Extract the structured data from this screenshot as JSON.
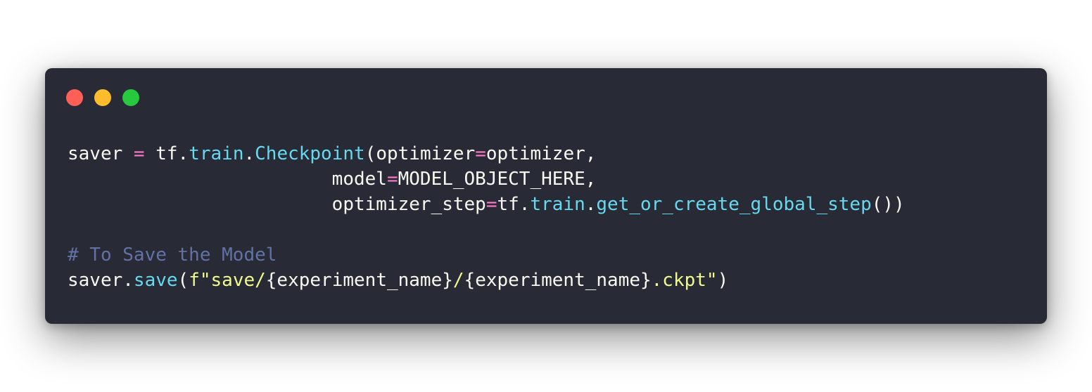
{
  "window": {
    "buttons": [
      {
        "name": "close",
        "color": "#ff5f56"
      },
      {
        "name": "minimize",
        "color": "#ffbd2e"
      },
      {
        "name": "maximize",
        "color": "#27c93f"
      }
    ]
  },
  "theme": {
    "background": "#282a36",
    "text": "#f8f8f2",
    "operator": "#ff79c6",
    "function": "#66d9ef",
    "string": "#f1fa8c",
    "comment": "#6272a4"
  },
  "code": {
    "lines": [
      [
        {
          "t": "saver ",
          "c": "text"
        },
        {
          "t": "=",
          "c": "op"
        },
        {
          "t": " tf.",
          "c": "text"
        },
        {
          "t": "train",
          "c": "fn"
        },
        {
          "t": ".",
          "c": "text"
        },
        {
          "t": "Checkpoint",
          "c": "fn"
        },
        {
          "t": "(optimizer",
          "c": "text"
        },
        {
          "t": "=",
          "c": "op"
        },
        {
          "t": "optimizer,",
          "c": "text"
        }
      ],
      [
        {
          "t": "                        model",
          "c": "text"
        },
        {
          "t": "=",
          "c": "op"
        },
        {
          "t": "MODEL_OBJECT_HERE,",
          "c": "text"
        }
      ],
      [
        {
          "t": "                        optimizer_step",
          "c": "text"
        },
        {
          "t": "=",
          "c": "op"
        },
        {
          "t": "tf.",
          "c": "text"
        },
        {
          "t": "train",
          "c": "fn"
        },
        {
          "t": ".",
          "c": "text"
        },
        {
          "t": "get_or_create_global_step",
          "c": "fn"
        },
        {
          "t": "())",
          "c": "text"
        }
      ],
      [],
      [
        {
          "t": "# To Save the Model",
          "c": "comment"
        }
      ],
      [
        {
          "t": "saver.",
          "c": "text"
        },
        {
          "t": "save",
          "c": "fn"
        },
        {
          "t": "(",
          "c": "text"
        },
        {
          "t": "f\"save/",
          "c": "str"
        },
        {
          "t": "{experiment_name}",
          "c": "text"
        },
        {
          "t": "/",
          "c": "str"
        },
        {
          "t": "{experiment_name}",
          "c": "text"
        },
        {
          "t": ".ckpt\"",
          "c": "str"
        },
        {
          "t": ")",
          "c": "text"
        }
      ]
    ]
  }
}
